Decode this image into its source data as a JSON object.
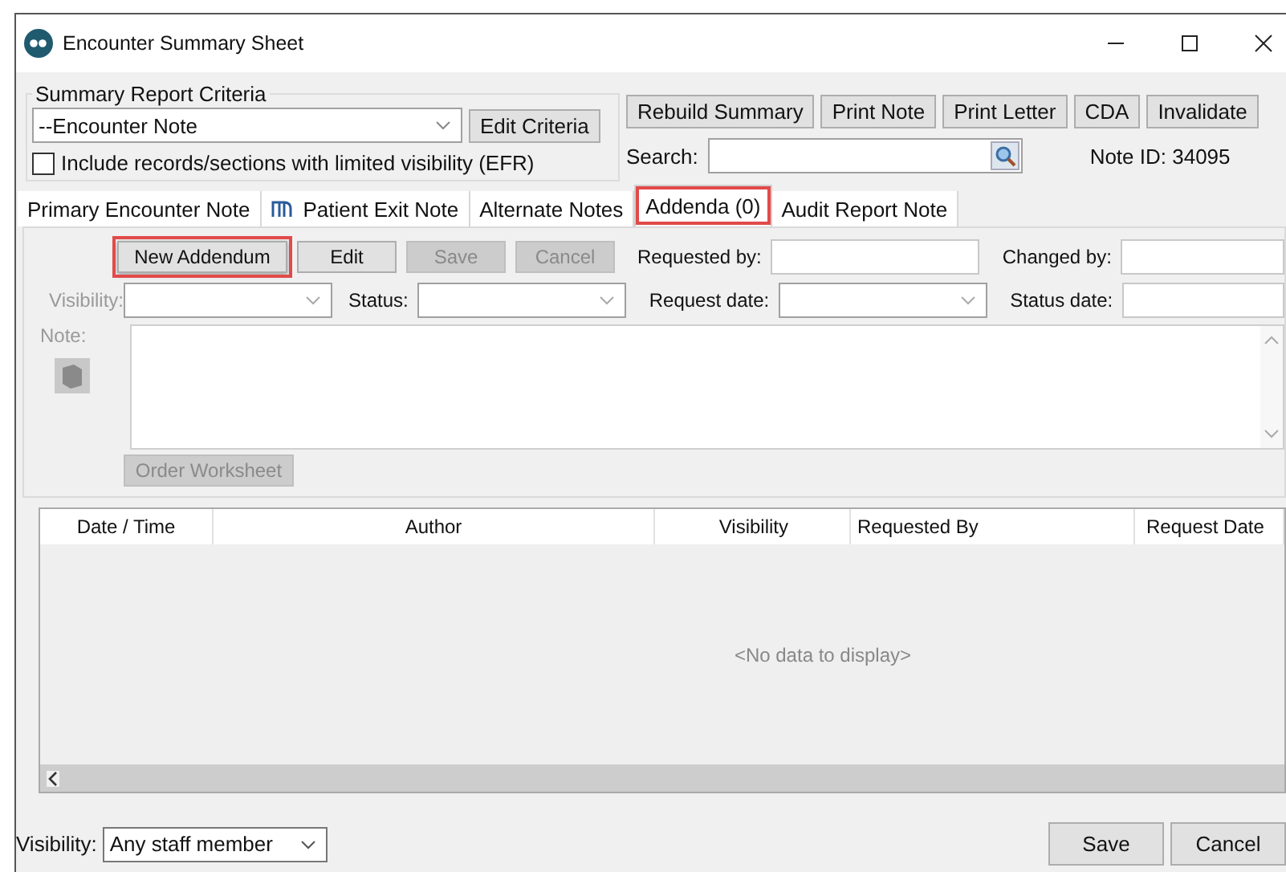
{
  "window": {
    "title": "Encounter Summary Sheet"
  },
  "criteria": {
    "legend": "Summary Report Criteria",
    "selection": "--Encounter Note",
    "edit_button": "Edit Criteria",
    "efr_checkbox": {
      "label": "Include records/sections with limited visibility (EFR)",
      "checked": false
    }
  },
  "toolbar_buttons": [
    "Rebuild Summary",
    "Print Note",
    "Print Letter",
    "CDA",
    "Invalidate"
  ],
  "search": {
    "label": "Search:"
  },
  "note_id": "Note ID: 34095",
  "tabs": [
    {
      "label": "Primary Encounter Note",
      "selected": false,
      "highlighted": false,
      "icon": false
    },
    {
      "label": "Patient Exit Note",
      "selected": false,
      "highlighted": false,
      "icon": true
    },
    {
      "label": "Alternate Notes",
      "selected": false,
      "highlighted": false,
      "icon": false
    },
    {
      "label": "Addenda (0)",
      "selected": true,
      "highlighted": true,
      "icon": false
    },
    {
      "label": "Audit Report Note",
      "selected": false,
      "highlighted": false,
      "icon": false
    }
  ],
  "addendum_buttons": [
    {
      "label": "New Addendum",
      "disabled": false,
      "highlighted": true
    },
    {
      "label": "Edit",
      "disabled": false,
      "highlighted": false
    },
    {
      "label": "Save",
      "disabled": true,
      "highlighted": false
    },
    {
      "label": "Cancel",
      "disabled": true,
      "highlighted": false
    }
  ],
  "fields": {
    "requested_by": "Requested by:",
    "changed_by": "Changed by:",
    "visibility": "Visibility:",
    "status": "Status:",
    "request_date": "Request date:",
    "status_date": "Status date:",
    "note": "Note:"
  },
  "order_worksheet": {
    "label": "Order Worksheet",
    "disabled": true
  },
  "table": {
    "columns": [
      "Date / Time",
      "Author",
      "Visibility",
      "Requested By",
      "Request Date"
    ],
    "empty_text": "<No data to display>"
  },
  "footer": {
    "visibility_label": "Visibility:",
    "visibility_value": "Any staff member",
    "buttons": [
      "Save",
      "Cancel"
    ]
  }
}
